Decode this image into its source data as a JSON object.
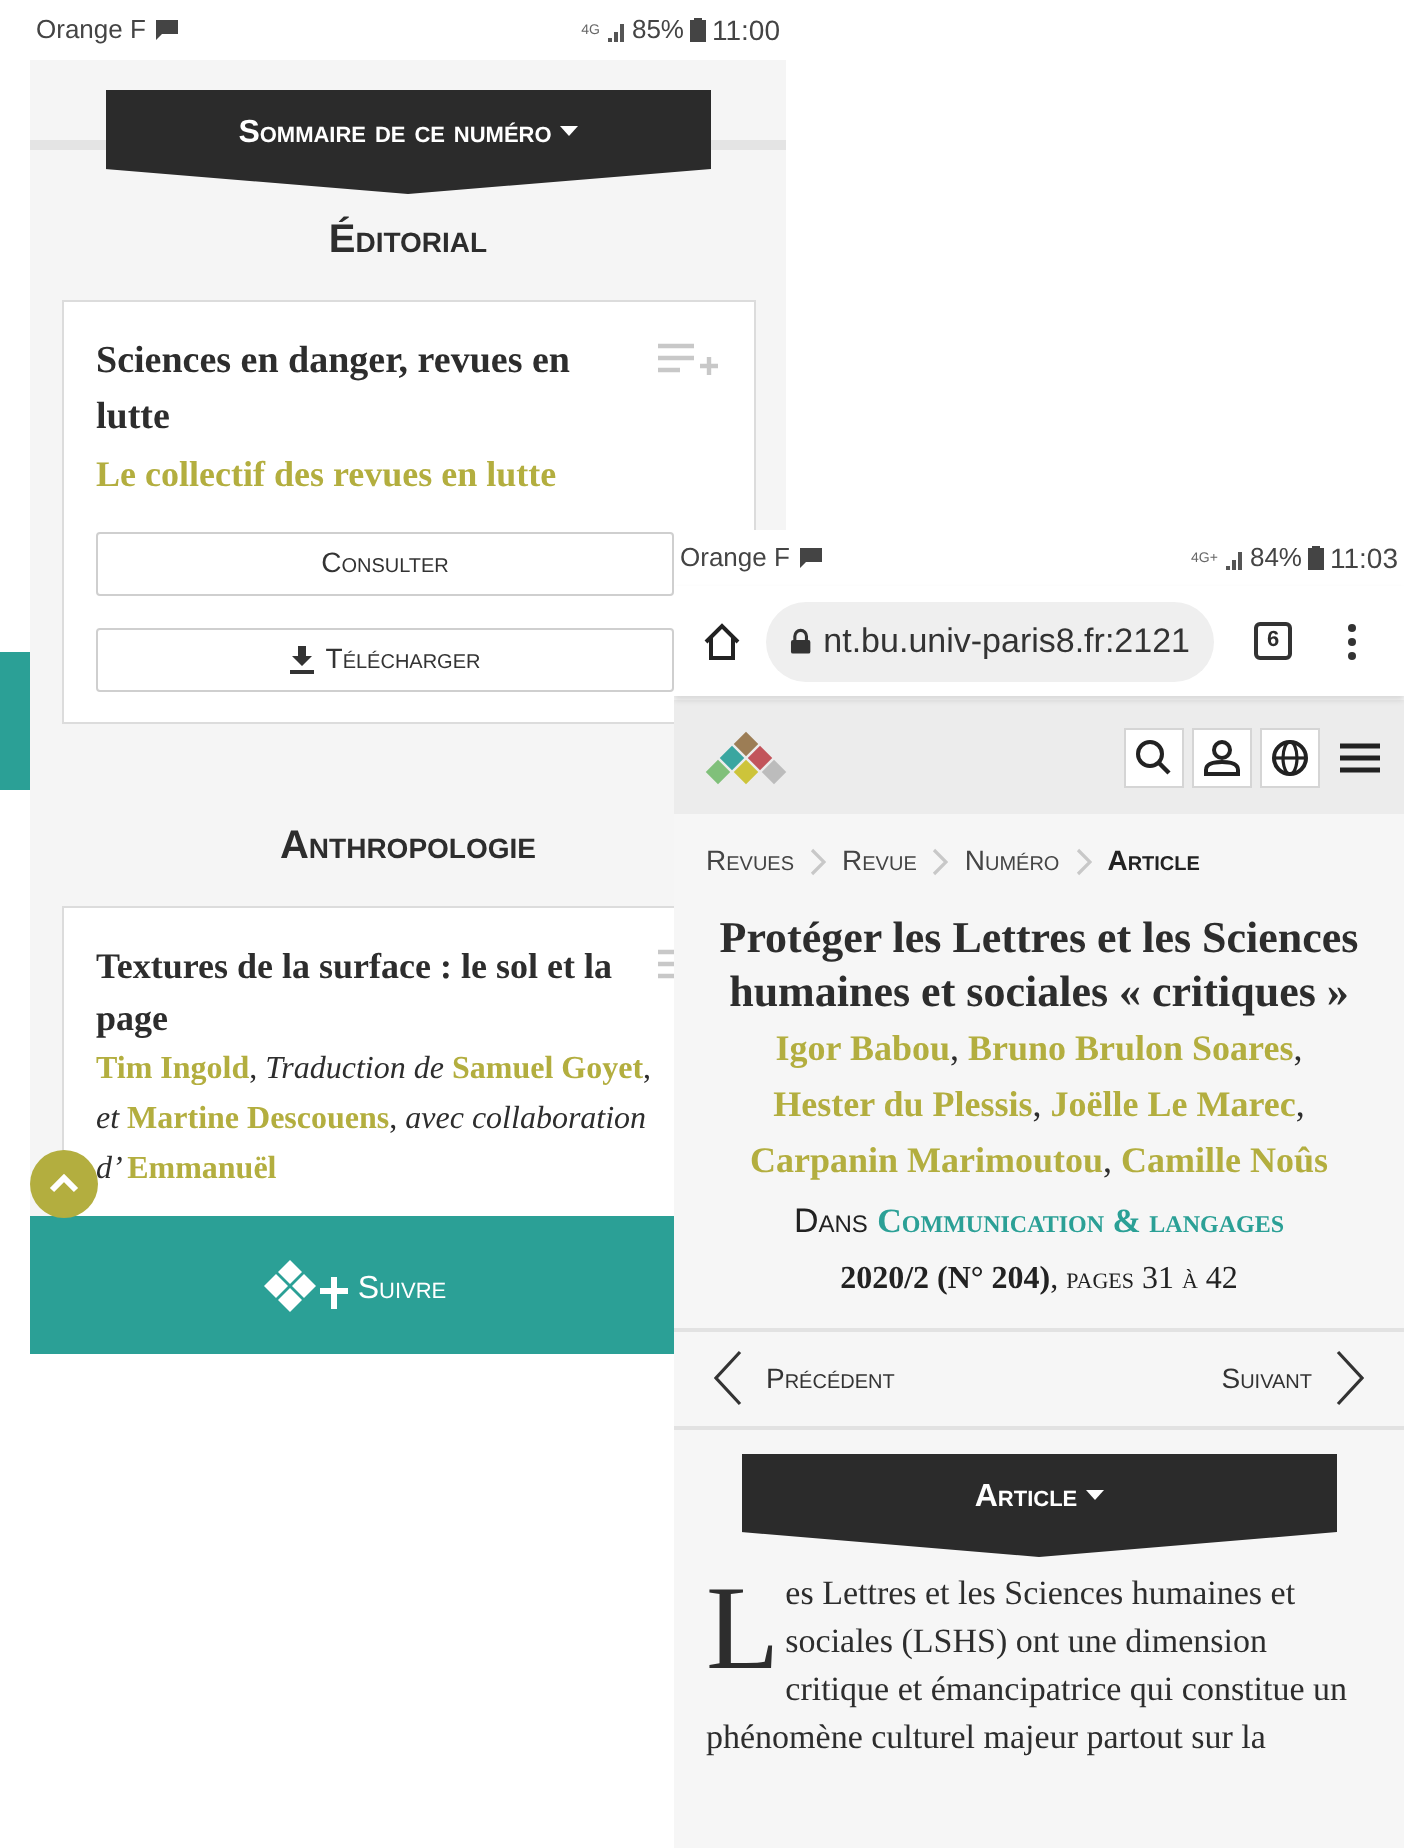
{
  "left_screen": {
    "status_bar": {
      "carrier": "Orange F",
      "network": "4G",
      "battery": "85%",
      "time": "11:00"
    },
    "toc_menu": {
      "label": "Sommaire de ce numéro"
    },
    "sections": [
      {
        "heading": "Éditorial",
        "article": {
          "title": "Sciences en danger, revues en lutte",
          "byline": [
            {
              "kind": "name",
              "text": "Le collectif des revues en lutte"
            }
          ],
          "buttons": [
            {
              "kind": "plain",
              "label": "Consulter"
            },
            {
              "kind": "download",
              "label": "Télécharger"
            }
          ]
        }
      },
      {
        "heading": "Anthropologie",
        "article": {
          "title": "Textures de la surface : le sol et la page",
          "byline": [
            {
              "kind": "name",
              "text": "Tim Ingold"
            },
            {
              "kind": "sep",
              "text": ", "
            },
            {
              "kind": "role",
              "text": "Traduction de "
            },
            {
              "kind": "name",
              "text": "Samuel Goyet"
            },
            {
              "kind": "sep",
              "text": ", "
            },
            {
              "kind": "role",
              "text": "et "
            },
            {
              "kind": "name",
              "text": "Martine Descouens"
            },
            {
              "kind": "sep",
              "text": ", "
            },
            {
              "kind": "role",
              "text": "avec collaboration d’ "
            },
            {
              "kind": "name",
              "text": "Emmanuël"
            }
          ]
        }
      }
    ],
    "follow_button": {
      "label": "Suivre"
    }
  },
  "right_screen": {
    "status_bar": {
      "carrier": "Orange F",
      "network": "4G+",
      "battery": "84%",
      "time": "11:03"
    },
    "browser": {
      "url": "nt.bu.univ-paris8.fr:2121",
      "tab_count": "6"
    },
    "breadcrumb": [
      {
        "label": "Revues",
        "current": false
      },
      {
        "label": "Revue",
        "current": false
      },
      {
        "label": "Numéro",
        "current": false
      },
      {
        "label": "Article",
        "current": true
      }
    ],
    "article": {
      "title": "Protéger les Lettres et les Sciences humaines et sociales « critiques »",
      "byline": [
        {
          "kind": "name",
          "text": "Igor Babou"
        },
        {
          "kind": "sep",
          "text": ", "
        },
        {
          "kind": "name",
          "text": "Bruno Brulon Soares"
        },
        {
          "kind": "sep",
          "text": ", "
        },
        {
          "kind": "name",
          "text": "Hester du Plessis"
        },
        {
          "kind": "sep",
          "text": ", "
        },
        {
          "kind": "name",
          "text": "Joëlle Le Marec"
        },
        {
          "kind": "sep",
          "text": ", "
        },
        {
          "kind": "name",
          "text": "Carpanin Marimoutou"
        },
        {
          "kind": "sep",
          "text": ", "
        },
        {
          "kind": "name",
          "text": "Camille Noûs"
        }
      ],
      "source_prefix": "Dans",
      "journal": "Communication & langages",
      "issue": "**2020/2 (N° 204)**, pages 31 à 42"
    },
    "pager": {
      "previous": "Précédent",
      "next": "Suivant"
    },
    "section_menu": {
      "label": "Article"
    },
    "body": {
      "drop_cap": "L",
      "text": "es Lettres et les Sciences humaines et sociales (LSHS) ont une dimension critique et émancipatrice qui constitue un phénomène culturel majeur partout sur la"
    }
  }
}
